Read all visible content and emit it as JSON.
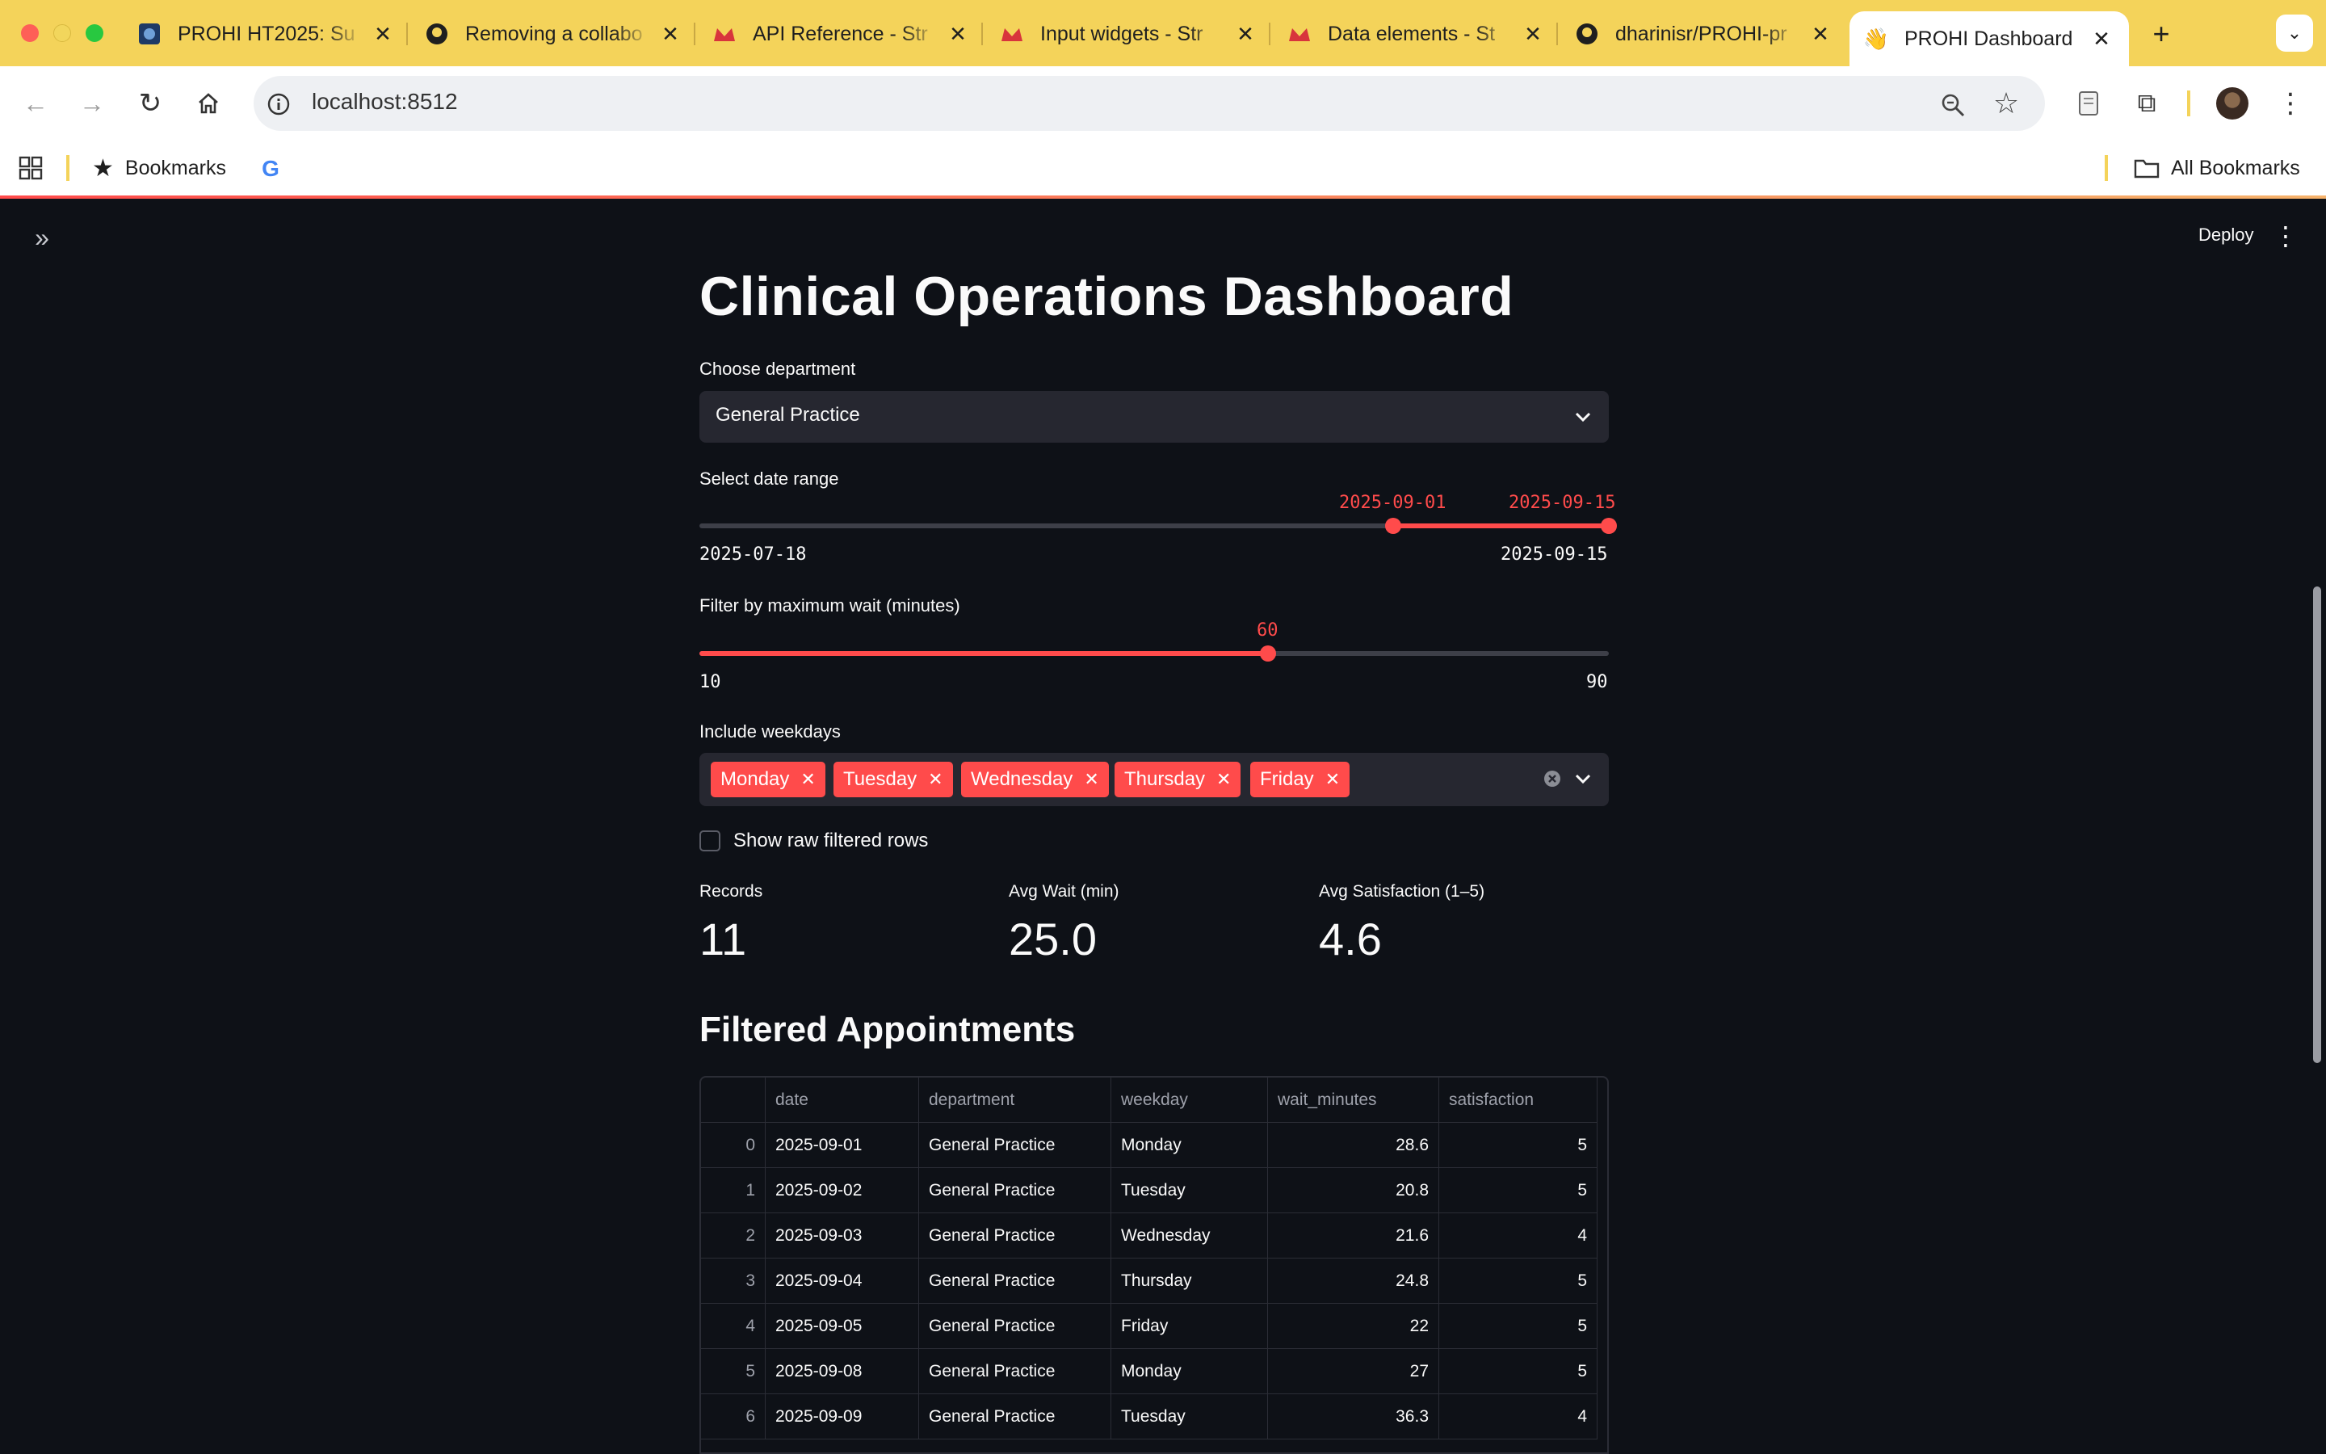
{
  "browser": {
    "tabs": [
      {
        "title": "PROHI HT2025: Su",
        "icon": "prohi-logo-icon"
      },
      {
        "title": "Removing a collabo",
        "icon": "github-icon"
      },
      {
        "title": "API Reference - Str",
        "icon": "streamlit-crown-icon"
      },
      {
        "title": "Input widgets - Str",
        "icon": "streamlit-crown-icon"
      },
      {
        "title": "Data elements - St",
        "icon": "streamlit-crown-icon"
      },
      {
        "title": "dharinisr/PROHI-pr",
        "icon": "github-icon"
      },
      {
        "title": "PROHI Dashboard",
        "icon": "waving-hand-icon"
      }
    ],
    "url": "localhost:8512",
    "bookmarks_label": "Bookmarks",
    "all_bookmarks_label": "All Bookmarks",
    "colors": {
      "tabbar": "#f4d35a",
      "accent": "#ff4b4b"
    }
  },
  "header": {
    "deploy_label": "Deploy"
  },
  "page": {
    "title": "Clinical Operations Dashboard",
    "department": {
      "label": "Choose department",
      "value": "General Practice"
    },
    "date_range": {
      "label": "Select date range",
      "min": "2025-07-18",
      "max": "2025-09-15",
      "start": "2025-09-01",
      "end": "2025-09-15",
      "start_fraction": 0.763,
      "end_fraction": 1.0
    },
    "max_wait": {
      "label": "Filter by maximum wait (minutes)",
      "min": "10",
      "max": "90",
      "value": "60",
      "fraction": 0.625
    },
    "weekdays": {
      "label": "Include weekdays",
      "selected": [
        "Monday",
        "Tuesday",
        "Wednesday",
        "Thursday",
        "Friday"
      ]
    },
    "show_raw": {
      "label": "Show raw filtered rows",
      "checked": false
    },
    "metrics": [
      {
        "label": "Records",
        "value": "11"
      },
      {
        "label": "Avg Wait (min)",
        "value": "25.0"
      },
      {
        "label": "Avg Satisfaction (1–5)",
        "value": "4.6"
      }
    ],
    "table": {
      "title": "Filtered Appointments",
      "columns": [
        "",
        "date",
        "department",
        "weekday",
        "wait_minutes",
        "satisfaction"
      ],
      "rows": [
        [
          "0",
          "2025-09-01",
          "General Practice",
          "Monday",
          "28.6",
          "5"
        ],
        [
          "1",
          "2025-09-02",
          "General Practice",
          "Tuesday",
          "20.8",
          "5"
        ],
        [
          "2",
          "2025-09-03",
          "General Practice",
          "Wednesday",
          "21.6",
          "4"
        ],
        [
          "3",
          "2025-09-04",
          "General Practice",
          "Thursday",
          "24.8",
          "5"
        ],
        [
          "4",
          "2025-09-05",
          "General Practice",
          "Friday",
          "22",
          "5"
        ],
        [
          "5",
          "2025-09-08",
          "General Practice",
          "Monday",
          "27",
          "5"
        ],
        [
          "6",
          "2025-09-09",
          "General Practice",
          "Tuesday",
          "36.3",
          "4"
        ]
      ]
    }
  }
}
